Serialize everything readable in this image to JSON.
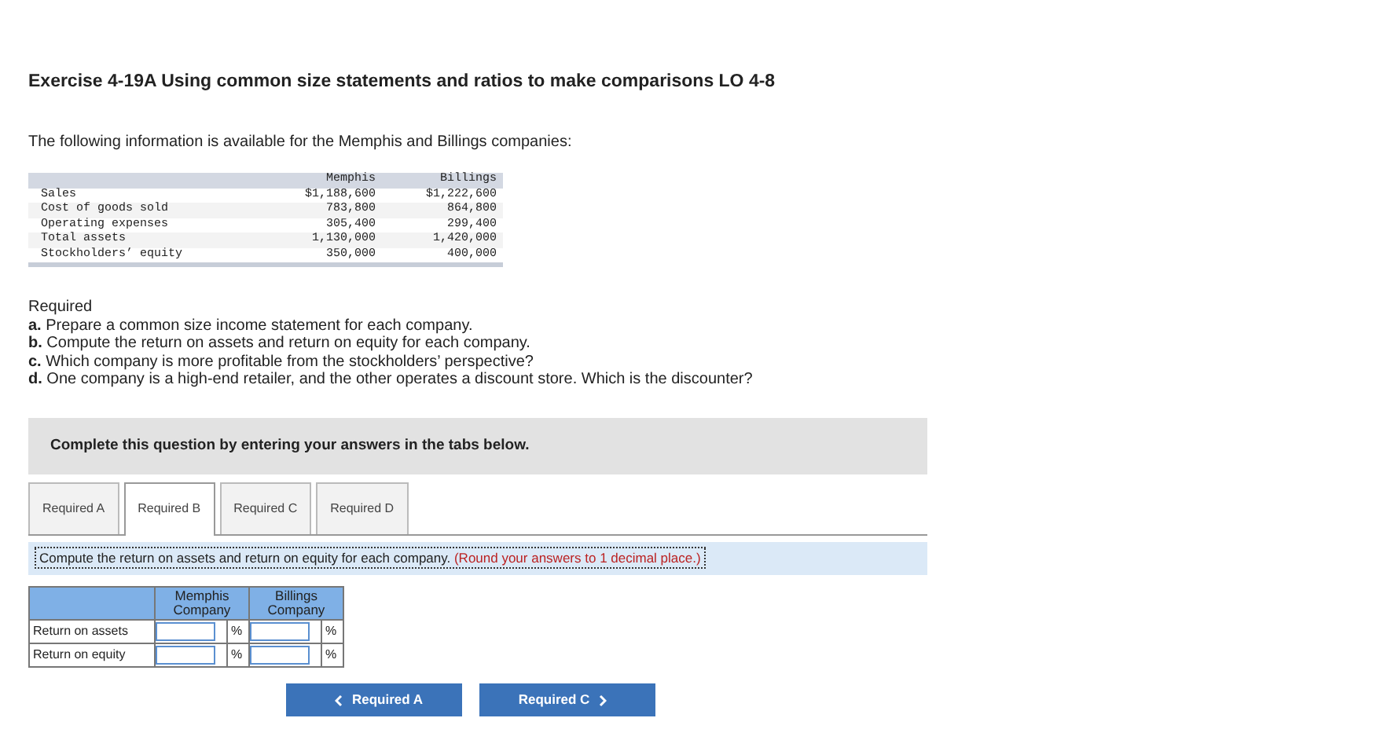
{
  "title": "Exercise 4-19A Using common size statements and ratios to make comparisons LO 4-8",
  "intro": "The following information is available for the Memphis and Billings companies:",
  "data_table": {
    "columns": [
      "Memphis",
      "Billings"
    ],
    "rows": [
      {
        "label": "Sales",
        "values": [
          "$1,188,600",
          "$1,222,600"
        ]
      },
      {
        "label": "Cost of goods sold",
        "values": [
          "783,800",
          "864,800"
        ]
      },
      {
        "label": "Operating expenses",
        "values": [
          "305,400",
          "299,400"
        ]
      },
      {
        "label": "Total assets",
        "values": [
          "1,130,000",
          "1,420,000"
        ]
      },
      {
        "label": "Stockholders’ equity",
        "values": [
          "350,000",
          "400,000"
        ]
      }
    ]
  },
  "required": {
    "heading": "Required",
    "items": [
      "**a.** Prepare a common size income statement for each company.",
      "**b.** Compute the return on assets and return on equity for each company.",
      "**c.** Which company is more profitable from the stockholders’ perspective?",
      "**d.** One company is a high-end retailer, and the other operates a discount store. Which is the discounter?"
    ]
  },
  "instruction_box": "Complete this question by entering your answers in the tabs below.",
  "tabs": [
    {
      "label": "Required A",
      "selected": false
    },
    {
      "label": "Required B",
      "selected": true
    },
    {
      "label": "Required C",
      "selected": false
    },
    {
      "label": "Required D",
      "selected": false
    }
  ],
  "task": {
    "text": "Compute the return on assets and return on equity for each company.",
    "note": "(Round your answers to 1 decimal place.)"
  },
  "answer_table": {
    "columns": [
      "Memphis Company",
      "Billings Company"
    ],
    "rows": [
      {
        "label": "Return on assets",
        "cells": [
          {
            "unit": "%"
          },
          {
            "unit": "%"
          }
        ]
      },
      {
        "label": "Return on equity",
        "cells": [
          {
            "unit": "%"
          },
          {
            "unit": "%"
          }
        ]
      }
    ]
  },
  "nav_buttons": [
    {
      "label": "Required A",
      "kind": "prev"
    },
    {
      "label": "Required C",
      "kind": "next"
    }
  ]
}
